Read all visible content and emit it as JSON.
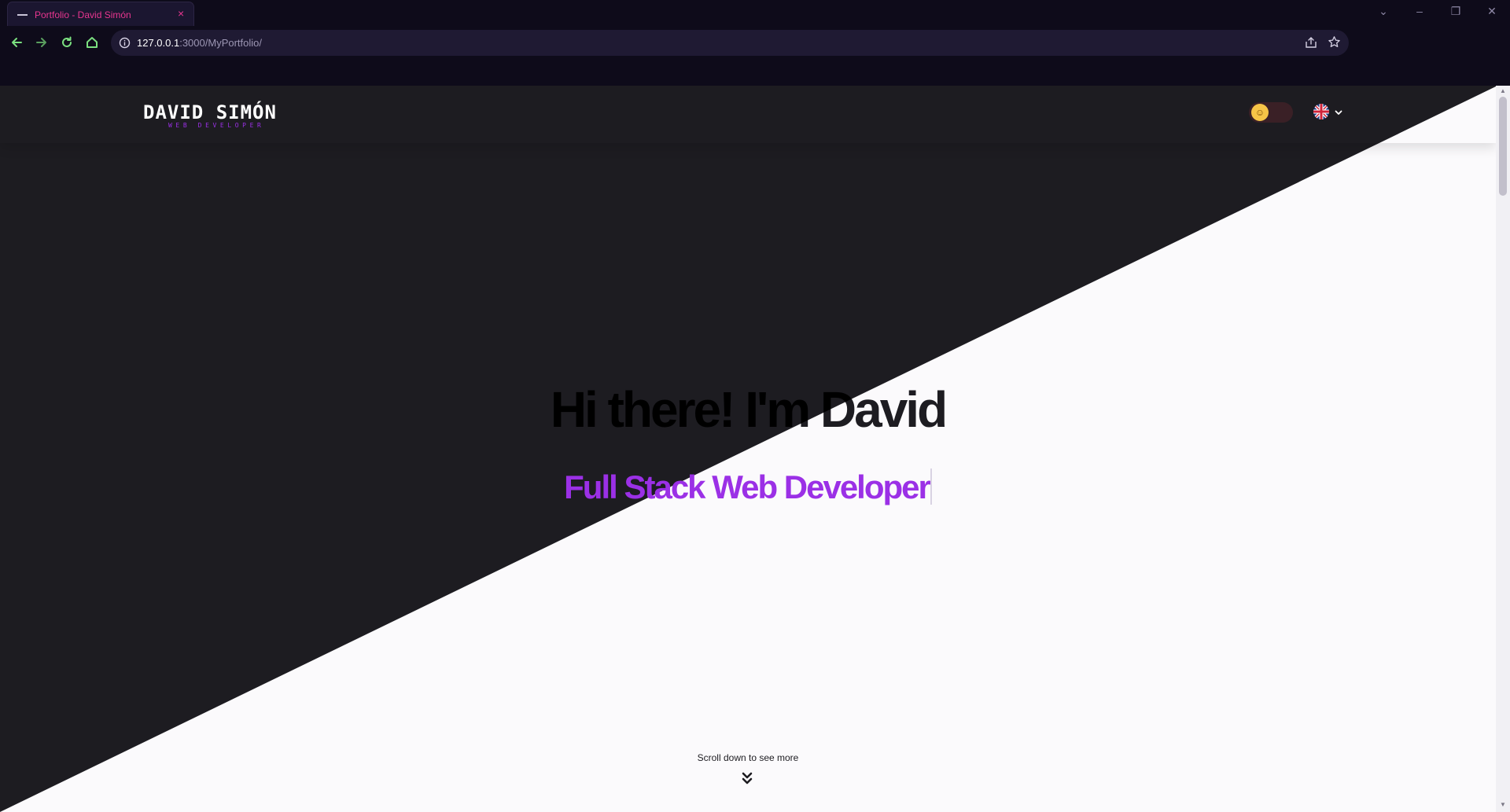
{
  "browser": {
    "tab_title": "Portfolio - David Simón",
    "tab_close": "×",
    "url_host": "127.0.0.1",
    "url_path": ":3000/MyPortfolio/",
    "window_controls": [
      "⌄",
      "–",
      "❐",
      "✕"
    ]
  },
  "nav": {
    "logo_name": "DAVID SIMÓN",
    "logo_subtitle": "WEB DEVELOPER",
    "theme_icon": "☺",
    "language_flag": "uk-flag-icon"
  },
  "hero": {
    "title": "Hi there! I'm David",
    "subtitle": "Full Stack Web Developer"
  },
  "footer_hint": {
    "text": "Scroll down to see more"
  },
  "colors": {
    "dark": "#1d1c21",
    "light": "#fbfafc",
    "accent": "#9b30e6",
    "tab_accent": "#e8368f"
  }
}
